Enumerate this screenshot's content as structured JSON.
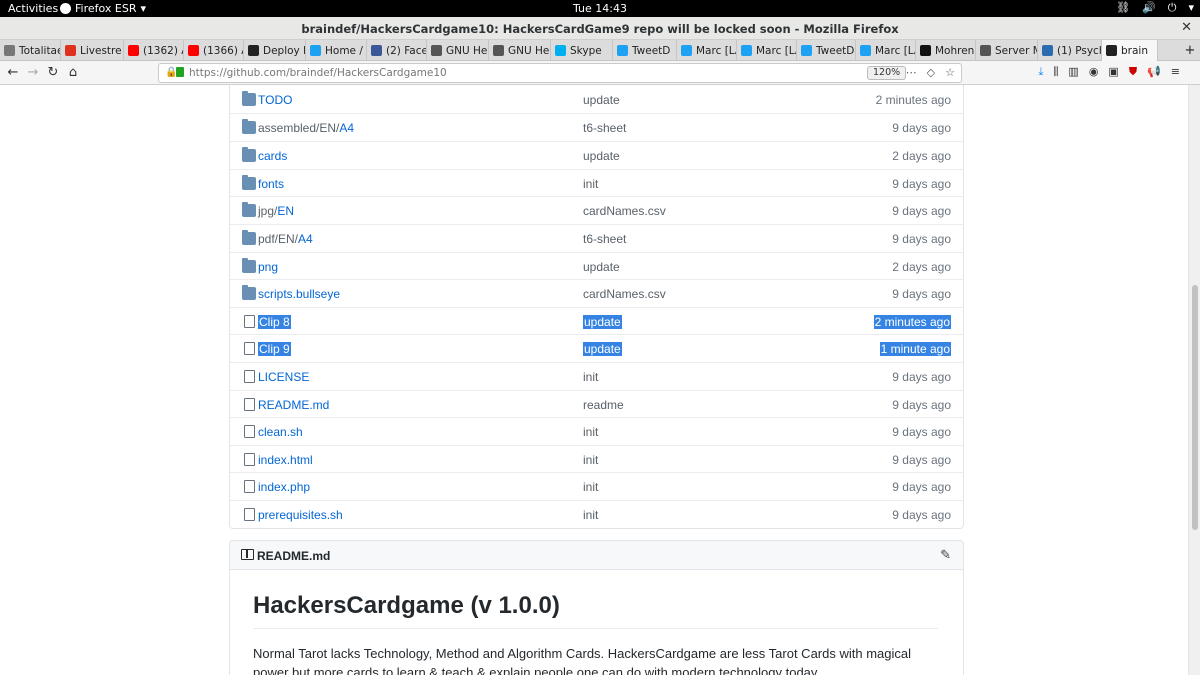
{
  "system_bar": {
    "activities": "Activities",
    "app_name": "Firefox ESR",
    "clock": "Tue 14:43"
  },
  "window": {
    "title": "braindef/HackersCardgame10: HackersCardGame9 repo will be locked soon - Mozilla Firefox"
  },
  "tabs": [
    {
      "label": "Totalitaer",
      "color": "#777777"
    },
    {
      "label": "Livestre",
      "color": "#e0301e"
    },
    {
      "label": "(1362) A",
      "color": "#ff0000"
    },
    {
      "label": "(1366) A",
      "color": "#ff0000"
    },
    {
      "label": "Deploy k",
      "color": "#222222"
    },
    {
      "label": "Home / T",
      "color": "#1da1f2"
    },
    {
      "label": "(2) Facel",
      "color": "#3b5998"
    },
    {
      "label": "GNU He",
      "color": "#555555"
    },
    {
      "label": "GNU He",
      "color": "#555555"
    },
    {
      "label": "Skype",
      "color": "#00aff0"
    },
    {
      "label": "TweetD",
      "color": "#1da1f2"
    },
    {
      "label": "Marc [LA",
      "color": "#1da1f2"
    },
    {
      "label": "Marc [LA",
      "color": "#1da1f2"
    },
    {
      "label": "TweetD",
      "color": "#1da1f2"
    },
    {
      "label": "Marc [LA",
      "color": "#1da1f2"
    },
    {
      "label": "Mohrenl",
      "color": "#111111"
    },
    {
      "label": "Server M",
      "color": "#555555"
    },
    {
      "label": "(1) Psych",
      "color": "#2b6cb0"
    },
    {
      "label": "brain",
      "color": "#222222",
      "active": true
    }
  ],
  "navbar": {
    "url_host": "https://github.com",
    "url_path": "/braindef/HackersCardgame10",
    "zoom": "120%"
  },
  "files": [
    {
      "prefix": "",
      "name": "TODO",
      "type": "folder",
      "message": "update",
      "age": "2 minutes ago",
      "selected": false
    },
    {
      "prefix": "assembled/EN/",
      "name": "A4",
      "type": "folder",
      "message": "t6-sheet",
      "age": "9 days ago",
      "selected": false
    },
    {
      "prefix": "",
      "name": "cards",
      "type": "folder",
      "message": "update",
      "age": "2 days ago",
      "selected": false
    },
    {
      "prefix": "",
      "name": "fonts",
      "type": "folder",
      "message": "init",
      "age": "9 days ago",
      "selected": false
    },
    {
      "prefix": "jpg/",
      "name": "EN",
      "type": "folder",
      "message": "cardNames.csv",
      "age": "9 days ago",
      "selected": false
    },
    {
      "prefix": "pdf/EN/",
      "name": "A4",
      "type": "folder",
      "message": "t6-sheet",
      "age": "9 days ago",
      "selected": false
    },
    {
      "prefix": "",
      "name": "png",
      "type": "folder",
      "message": "update",
      "age": "2 days ago",
      "selected": false
    },
    {
      "prefix": "",
      "name": "scripts.bullseye",
      "type": "folder",
      "message": "cardNames.csv",
      "age": "9 days ago",
      "selected": false
    },
    {
      "prefix": "",
      "name": "Clip 8",
      "type": "file",
      "message": "update",
      "age": "2 minutes ago",
      "selected": true
    },
    {
      "prefix": "",
      "name": "Clip 9",
      "type": "file",
      "message": "update",
      "age": "1 minute ago",
      "selected": true
    },
    {
      "prefix": "",
      "name": "LICENSE",
      "type": "file",
      "message": "init",
      "age": "9 days ago",
      "selected": false
    },
    {
      "prefix": "",
      "name": "README.md",
      "type": "file",
      "message": "readme",
      "age": "9 days ago",
      "selected": false
    },
    {
      "prefix": "",
      "name": "clean.sh",
      "type": "file",
      "message": "init",
      "age": "9 days ago",
      "selected": false
    },
    {
      "prefix": "",
      "name": "index.html",
      "type": "file",
      "message": "init",
      "age": "9 days ago",
      "selected": false
    },
    {
      "prefix": "",
      "name": "index.php",
      "type": "file",
      "message": "init",
      "age": "9 days ago",
      "selected": false
    },
    {
      "prefix": "",
      "name": "prerequisites.sh",
      "type": "file",
      "message": "init",
      "age": "9 days ago",
      "selected": false
    }
  ],
  "readme": {
    "header": "README.md",
    "title": "HackersCardgame (v 1.0.0)",
    "paragraph": "Normal Tarot lacks Technology, Method and Algorithm Cards. HackersCardgame are less Tarot Cards with magical power but more cards to learn & teach & explain people one can do with modern technology today."
  }
}
